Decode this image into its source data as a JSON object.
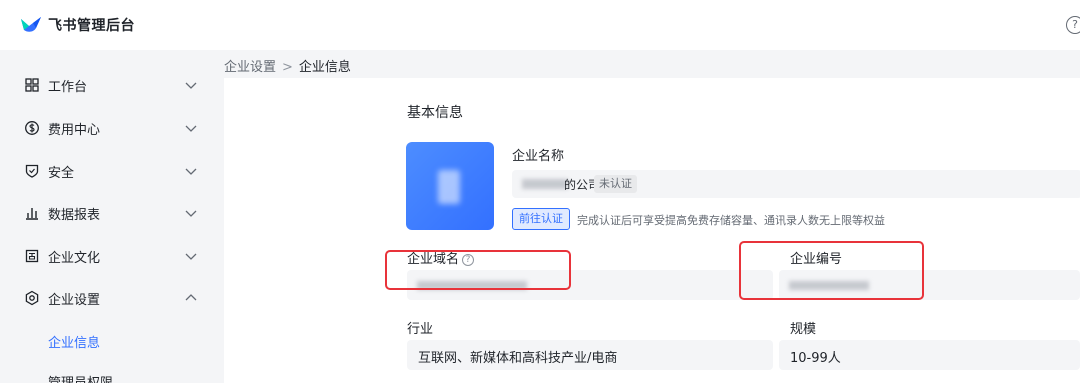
{
  "app": {
    "title": "飞书管理后台",
    "help": "?"
  },
  "sidebar": {
    "items": [
      {
        "label": "工作台",
        "icon": "grid-icon"
      },
      {
        "label": "费用中心",
        "icon": "coin-icon"
      },
      {
        "label": "安全",
        "icon": "shield-icon"
      },
      {
        "label": "数据报表",
        "icon": "bar-chart-icon"
      },
      {
        "label": "企业文化",
        "icon": "culture-icon"
      },
      {
        "label": "企业设置",
        "icon": "settings-icon"
      }
    ],
    "sub_items": [
      {
        "label": "企业信息",
        "active": true
      },
      {
        "label": "管理员权限",
        "active": false
      }
    ]
  },
  "breadcrumb": {
    "parent": "企业设置",
    "separator": ">",
    "current": "企业信息"
  },
  "main": {
    "section_title": "基本信息",
    "company_name": {
      "label": "企业名称",
      "value_suffix": "的公司",
      "badge": "未认证"
    },
    "verify": {
      "button": "前往认证",
      "tip": "完成认证后可享受提高免费存储容量、通讯录人数无上限等权益"
    },
    "domain": {
      "label": "企业域名",
      "help": "?"
    },
    "number": {
      "label": "企业编号"
    },
    "industry": {
      "label": "行业",
      "value": "互联网、新媒体和高科技产业/电商"
    },
    "scale": {
      "label": "规模",
      "value": "10-99人"
    }
  },
  "colors": {
    "accent": "#3370ff",
    "highlight": "#e8333a",
    "background": "#f4f5f7"
  }
}
